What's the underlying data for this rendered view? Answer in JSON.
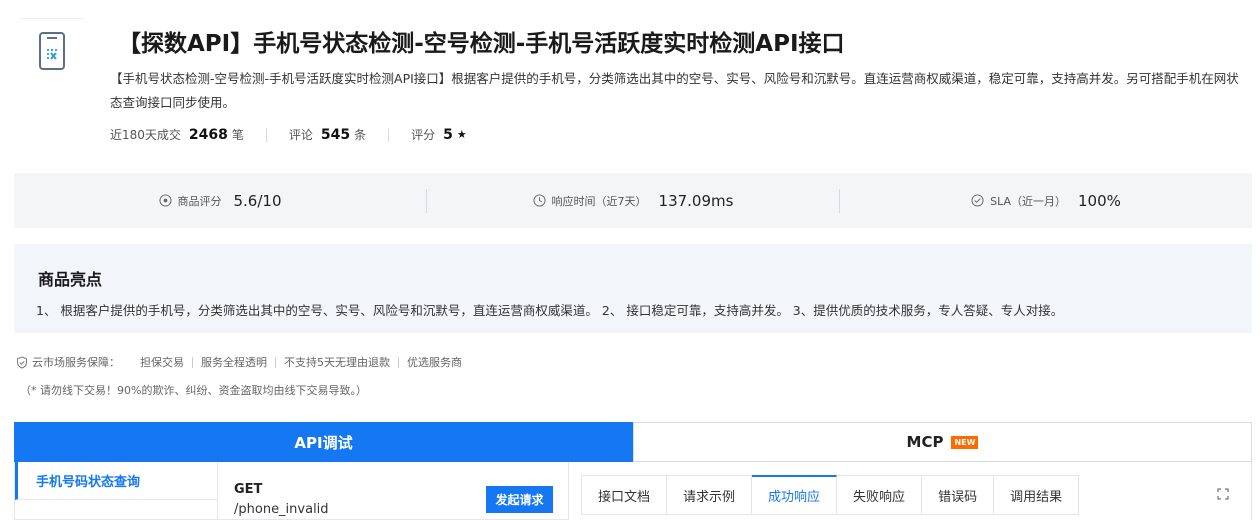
{
  "product": {
    "icon": "phone-check-icon",
    "title": "【探数API】手机号状态检测-空号检测-手机号活跃度实时检测API接口",
    "description": "【手机号状态检测-空号检测-手机号活跃度实时检测API接口】根据客户提供的手机号，分类筛选出其中的空号、实号、风险号和沉默号。直连运营商权威渠道，稳定可靠，支持高并发。另可搭配手机在网状态查询接口同步使用。",
    "stats": [
      {
        "label": "近180天成交",
        "value": "2468",
        "unit": "笔"
      },
      {
        "label": "评论",
        "value": "545",
        "unit": "条"
      },
      {
        "label": "评分",
        "value": "5",
        "unit": "★"
      }
    ]
  },
  "metrics": [
    {
      "icon": "target-icon",
      "label": "商品评分",
      "value": "5.6/10"
    },
    {
      "icon": "clock-icon",
      "label": "响应时间（近7天）",
      "value": "137.09ms"
    },
    {
      "icon": "check-circle-icon",
      "label": "SLA（近一月）",
      "value": "100%"
    }
  ],
  "highlights": {
    "title": "商品亮点",
    "text": "1、 根据客户提供的手机号，分类筛选出其中的空号、实号、风险号和沉默号，直连运营商权威渠道。 2、 接口稳定可靠，支持高并发。 3、提供优质的技术服务，专人答疑、专人对接。"
  },
  "guarantee": {
    "label": "云市场服务保障：",
    "items": [
      "担保交易",
      "服务全程透明",
      "不支持5天无理由退款",
      "优选服务商"
    ],
    "warning": "（* 请勿线下交易！90%的欺诈、纠纷、资金盗取均由线下交易导致。）"
  },
  "main_tabs": {
    "api": "API调试",
    "mcp": "MCP",
    "new_badge": "NEW"
  },
  "sidebar": {
    "items": [
      {
        "label": "手机号码状态查询"
      }
    ]
  },
  "endpoint": {
    "method": "GET",
    "path": "/phone_invalid",
    "send_label": "发起请求"
  },
  "response_tabs": [
    "接口文档",
    "请求示例",
    "成功响应",
    "失败响应",
    "错误码",
    "调用结果"
  ],
  "active_response_tab": "成功响应",
  "colors": {
    "accent": "#1677f2",
    "badge": "#ff6a00"
  }
}
